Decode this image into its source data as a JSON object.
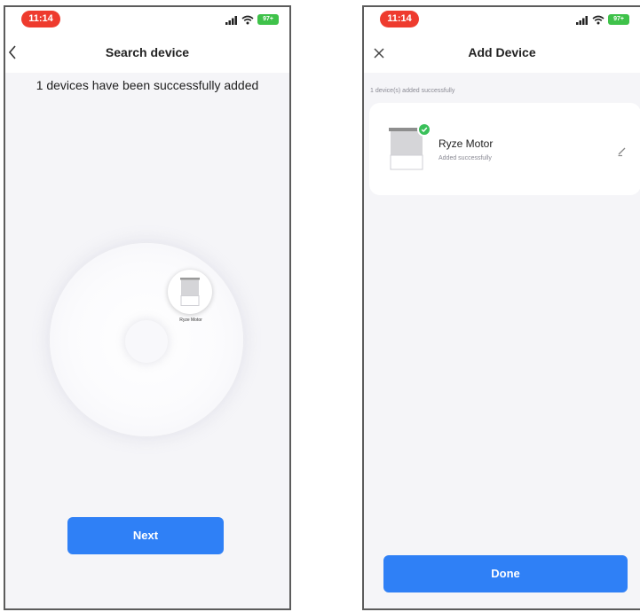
{
  "left_screen": {
    "status_bar": {
      "time": "11:14",
      "battery": "97+"
    },
    "nav": {
      "title": "Search device"
    },
    "message": "1 devices have been successfully added",
    "found_device": {
      "name": "Ryze Motor"
    },
    "next_label": "Next"
  },
  "right_screen": {
    "status_bar": {
      "time": "11:14",
      "battery": "97+"
    },
    "nav": {
      "title": "Add Device"
    },
    "caption": "1 device(s) added successfully",
    "device": {
      "name": "Ryze Motor",
      "status": "Added successfully"
    },
    "done_label": "Done"
  },
  "colors": {
    "accent": "#2f80f6",
    "success": "#3ac05a",
    "time_pill": "#ee3b2e",
    "battery": "#3fc24a"
  },
  "icons": [
    "signal-icon",
    "wifi-icon",
    "battery-icon",
    "chevron-left-icon",
    "close-icon",
    "blind-icon",
    "check-icon",
    "edit-icon"
  ]
}
